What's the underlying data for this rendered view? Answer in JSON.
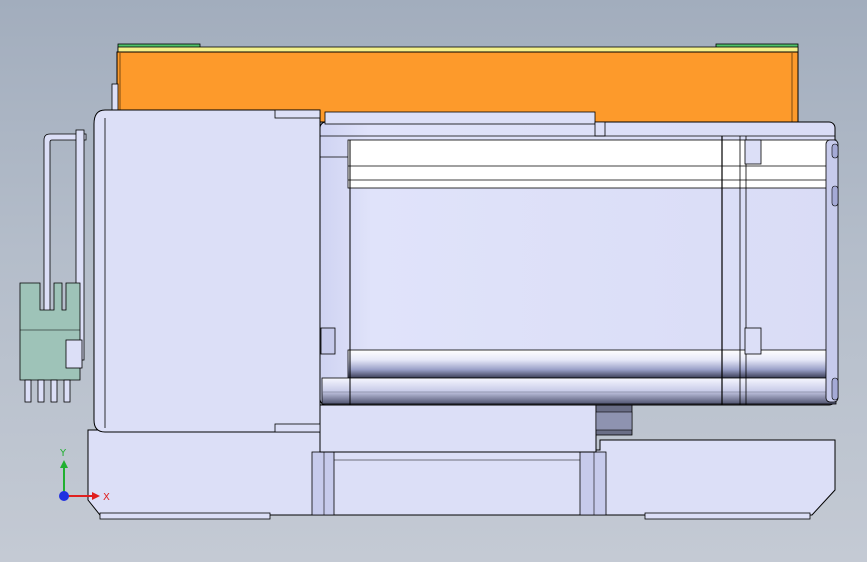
{
  "viewport": {
    "background_top": "#a2adbd",
    "background_bottom": "#c4cad4"
  },
  "model": {
    "part_fill": "#dcdff7",
    "part_shadow": "#b8bde6",
    "edge_color": "#000000",
    "top_plate_color": "#fd9a2b",
    "top_strip_color": "#f4f08a",
    "green_pad_color": "#4fc26a",
    "connector_color": "#9ec3b8"
  },
  "triad": {
    "x_label": "X",
    "y_label": "Y",
    "x_color": "#e02020",
    "y_color": "#20b030",
    "z_color": "#2030e0"
  }
}
